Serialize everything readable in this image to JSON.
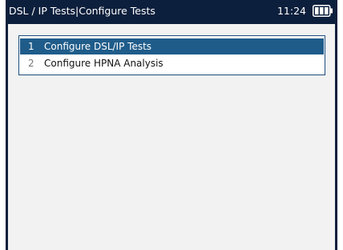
{
  "header": {
    "title": "DSL / IP Tests|Configure Tests",
    "time": "11:24"
  },
  "menu": {
    "items": [
      {
        "number": "1",
        "label": "Configure DSL/IP Tests",
        "selected": true
      },
      {
        "number": "2",
        "label": "Configure HPNA Analysis",
        "selected": false
      }
    ]
  },
  "colors": {
    "frame": "#0c1f3c",
    "background": "#f2f2f2",
    "selection": "#1f5c8a"
  },
  "icons": {
    "battery": "battery-icon"
  }
}
